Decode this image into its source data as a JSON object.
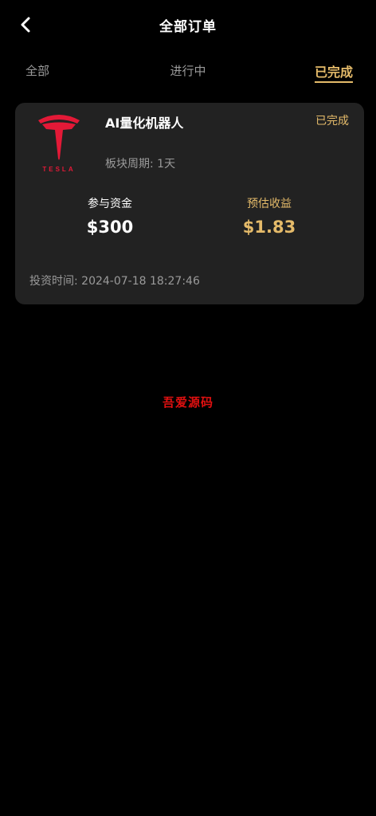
{
  "header": {
    "title": "全部订单",
    "back_icon": "chevron-left-icon"
  },
  "tabs": [
    {
      "label": "全部",
      "active": false
    },
    {
      "label": "进行中",
      "active": false
    },
    {
      "label": "已完成",
      "active": true
    }
  ],
  "orders": [
    {
      "logo_icon": "tesla-logo-icon",
      "logo_text": "TESLA",
      "product_name": "AI量化机器人",
      "status": "已完成",
      "period_label": "板块周期: 1天",
      "funds_label": "参与资金",
      "funds_value": "$300",
      "earnings_label": "预估收益",
      "earnings_value": "$1.83",
      "invest_time": "投资时间: 2024-07-18 18:27:46"
    }
  ],
  "watermark": "吾爱源码",
  "colors": {
    "accent": "#e5bb6a",
    "background": "#000000",
    "card": "#222222",
    "muted_text": "#9a9a9a",
    "watermark": "#e01010",
    "logo_red": "#e31937"
  }
}
